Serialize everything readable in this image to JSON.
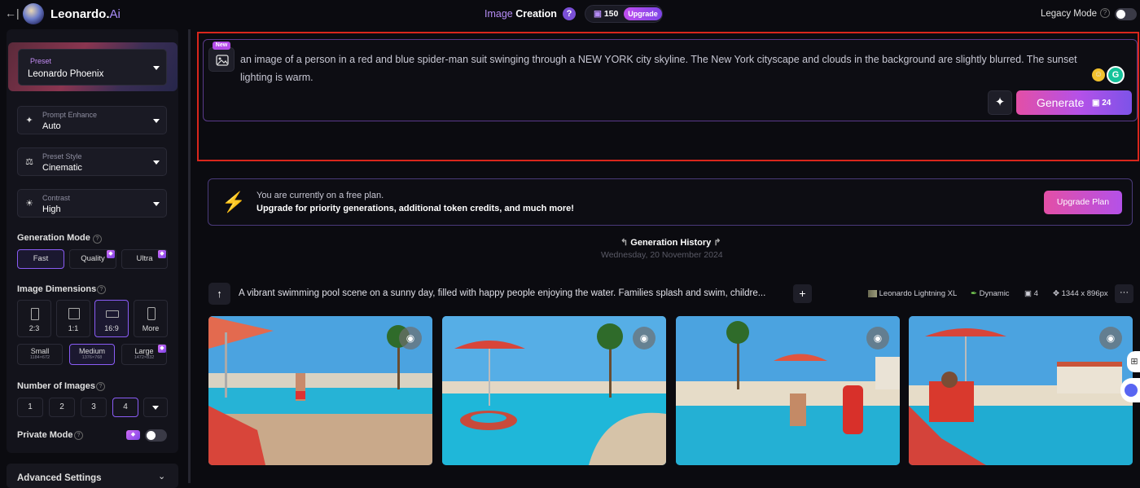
{
  "header": {
    "back_icon": "←|",
    "brand": "Leonardo.",
    "brand_suffix": "Ai",
    "mode_prefix": "Image",
    "mode_bold": "Creation",
    "help": "?",
    "tokens": "150",
    "upgrade": "Upgrade",
    "legacy_mode": "Legacy Mode",
    "legacy_help": "?"
  },
  "sidebar": {
    "preset": {
      "label": "Preset",
      "value": "Leonardo Phoenix"
    },
    "prompt_enhance": {
      "label": "Prompt Enhance",
      "value": "Auto"
    },
    "preset_style": {
      "label": "Preset Style",
      "value": "Cinematic"
    },
    "contrast": {
      "label": "Contrast",
      "value": "High"
    },
    "generation_mode": {
      "label": "Generation Mode",
      "options": [
        "Fast",
        "Quality",
        "Ultra"
      ]
    },
    "image_dimensions": {
      "label": "Image Dimensions",
      "ratios": [
        "2:3",
        "1:1",
        "16:9",
        "More"
      ]
    },
    "sizes": [
      {
        "label": "Small",
        "dims": "1184×672"
      },
      {
        "label": "Medium",
        "dims": "1376×768"
      },
      {
        "label": "Large",
        "dims": "1472×832"
      }
    ],
    "number_of_images": {
      "label": "Number of Images",
      "options": [
        "1",
        "2",
        "3",
        "4"
      ]
    },
    "private_mode": "Private Mode",
    "advanced_settings": "Advanced Settings"
  },
  "prompt": {
    "new_badge": "New",
    "text": "an image of a person in a red and blue spider-man suit swinging through a NEW YORK city skyline. The New York cityscape and clouds in the background are slightly blurred. The sunset lighting is warm.",
    "generate": "Generate",
    "generate_cost": "24"
  },
  "plan_banner": {
    "line1": "You are currently on a free plan.",
    "line2": "Upgrade for priority generations, additional token credits, and much more!",
    "button": "Upgrade Plan"
  },
  "history": {
    "title": "Generation History",
    "date": "Wednesday, 20 November 2024",
    "prompt": "A vibrant swimming pool scene on a sunny day, filled with happy people enjoying the water. Families splash and swim, childre...",
    "model": "Leonardo Lightning XL",
    "style": "Dynamic",
    "count": "4",
    "dimensions": "1344 x 896px"
  },
  "icons": {
    "back": "back-arrow-icon",
    "image": "image-icon",
    "sparkle": "sparkle-icon",
    "bolt": "lightning-bolt-icon",
    "eye": "eye-icon"
  },
  "colors": {
    "accent": "#b451e8",
    "highlight": "#d9261c",
    "bolt": "#f7b21e"
  }
}
